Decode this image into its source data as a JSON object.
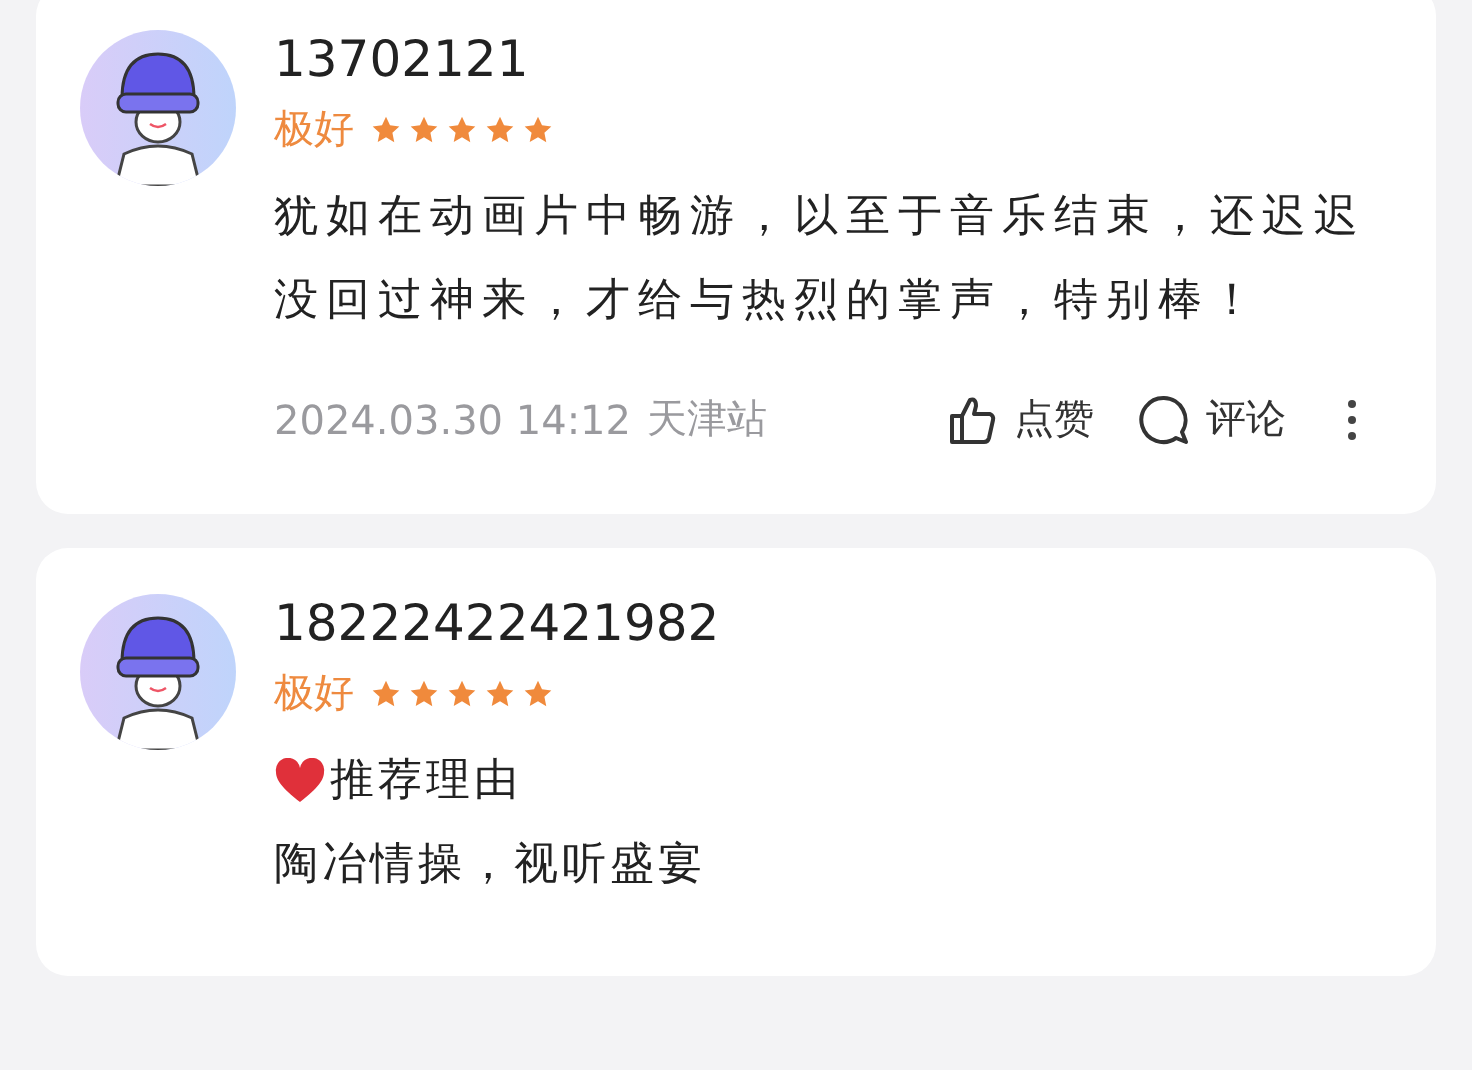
{
  "reviews": [
    {
      "username": "13702121",
      "rating_label": "极好",
      "stars": 5,
      "blocks": [
        {
          "kind": "text",
          "text": "犹如在动画片中畅游，以至于音乐结束，还迟迟没回过神来，才给与热烈的掌声，特别棒！"
        }
      ],
      "footer": {
        "time": "2024.03.30 14:12",
        "location": "天津站",
        "like": "点赞",
        "comment": "评论"
      }
    },
    {
      "username": "18222422421982",
      "rating_label": "极好",
      "stars": 5,
      "blocks": [
        {
          "kind": "heading",
          "text": "推荐理由"
        },
        {
          "kind": "text",
          "text": "陶冶情操，视听盛宴"
        }
      ]
    }
  ]
}
